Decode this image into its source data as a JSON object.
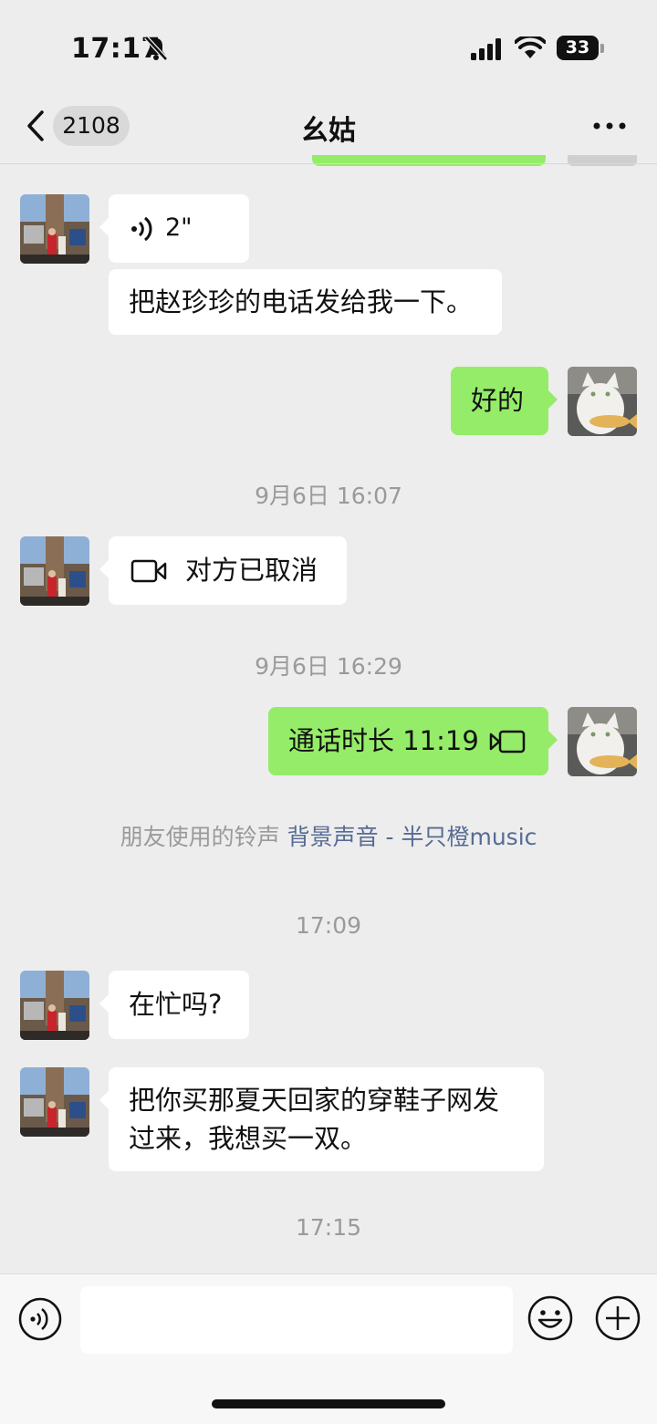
{
  "status_bar": {
    "time": "17:17",
    "battery": "33",
    "icons": [
      "bell-slash-icon",
      "signal-bars-icon",
      "wifi-icon",
      "battery-icon"
    ]
  },
  "nav": {
    "unread_count": "2108",
    "title": "幺姑",
    "icons": [
      "chevron-left-icon",
      "more-icon"
    ]
  },
  "messages": [
    {
      "side": "left",
      "type": "voice",
      "duration": "2\""
    },
    {
      "side": "left",
      "type": "text",
      "text": "把赵珍珍的电话发给我一下。"
    },
    {
      "side": "right",
      "type": "text",
      "text": "好的"
    },
    {
      "type": "timestamp",
      "text": "9月6日 16:07"
    },
    {
      "side": "left",
      "type": "video-call",
      "text": "对方已取消"
    },
    {
      "type": "timestamp",
      "text": "9月6日 16:29"
    },
    {
      "side": "right",
      "type": "video-call",
      "text": "通话时长 11:19"
    },
    {
      "type": "ringtone",
      "prefix": "朋友使用的铃声",
      "link": "背景声音 - 半只橙music"
    },
    {
      "type": "timestamp",
      "text": "17:09"
    },
    {
      "side": "left",
      "type": "text",
      "text": "在忙吗?"
    },
    {
      "side": "left",
      "type": "text",
      "lines": [
        "把你买那夏天回家的穿鞋子网发",
        "过来，我想买一双。"
      ]
    },
    {
      "type": "timestamp",
      "text": "17:15"
    }
  ],
  "input_bar": {
    "value": "",
    "icons": [
      "voice-icon",
      "emoji-icon",
      "plus-icon"
    ]
  },
  "colors": {
    "background": "#ededed",
    "bubble_self": "#95ec69",
    "bubble_other": "#ffffff",
    "link": "#576b95"
  }
}
